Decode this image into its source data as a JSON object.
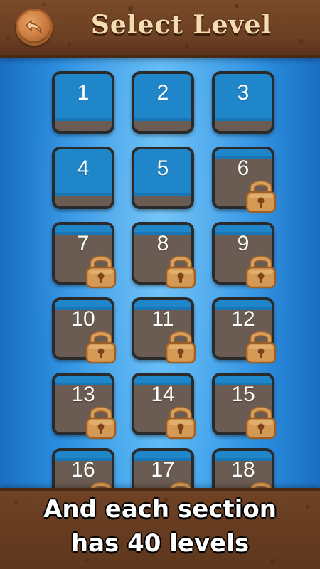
{
  "header": {
    "title": "Select Level",
    "back_icon": "back-arrow-icon"
  },
  "levels": [
    {
      "label": "1",
      "water": 0.82,
      "locked": false
    },
    {
      "label": "2",
      "water": 0.82,
      "locked": false
    },
    {
      "label": "3",
      "water": 0.82,
      "locked": false
    },
    {
      "label": "4",
      "water": 0.82,
      "locked": false
    },
    {
      "label": "5",
      "water": 0.82,
      "locked": false
    },
    {
      "label": "6",
      "water": 0.18,
      "locked": true
    },
    {
      "label": "7",
      "water": 0.18,
      "locked": true
    },
    {
      "label": "8",
      "water": 0.18,
      "locked": true
    },
    {
      "label": "9",
      "water": 0.18,
      "locked": true
    },
    {
      "label": "10",
      "water": 0.18,
      "locked": true
    },
    {
      "label": "11",
      "water": 0.18,
      "locked": true
    },
    {
      "label": "12",
      "water": 0.18,
      "locked": true
    },
    {
      "label": "13",
      "water": 0.18,
      "locked": true
    },
    {
      "label": "14",
      "water": 0.18,
      "locked": true
    },
    {
      "label": "15",
      "water": 0.18,
      "locked": true
    },
    {
      "label": "16",
      "water": 0.18,
      "locked": true
    },
    {
      "label": "17",
      "water": 0.18,
      "locked": true
    },
    {
      "label": "18",
      "water": 0.18,
      "locked": true
    }
  ],
  "footer": {
    "line1": "And each section",
    "line2": "has 40 levels"
  },
  "colors": {
    "wood": "#6b3f22",
    "water": "#1f86c9",
    "dirt": "#6a5c52",
    "lock": "#d49a55",
    "title": "#f6dcb1"
  }
}
